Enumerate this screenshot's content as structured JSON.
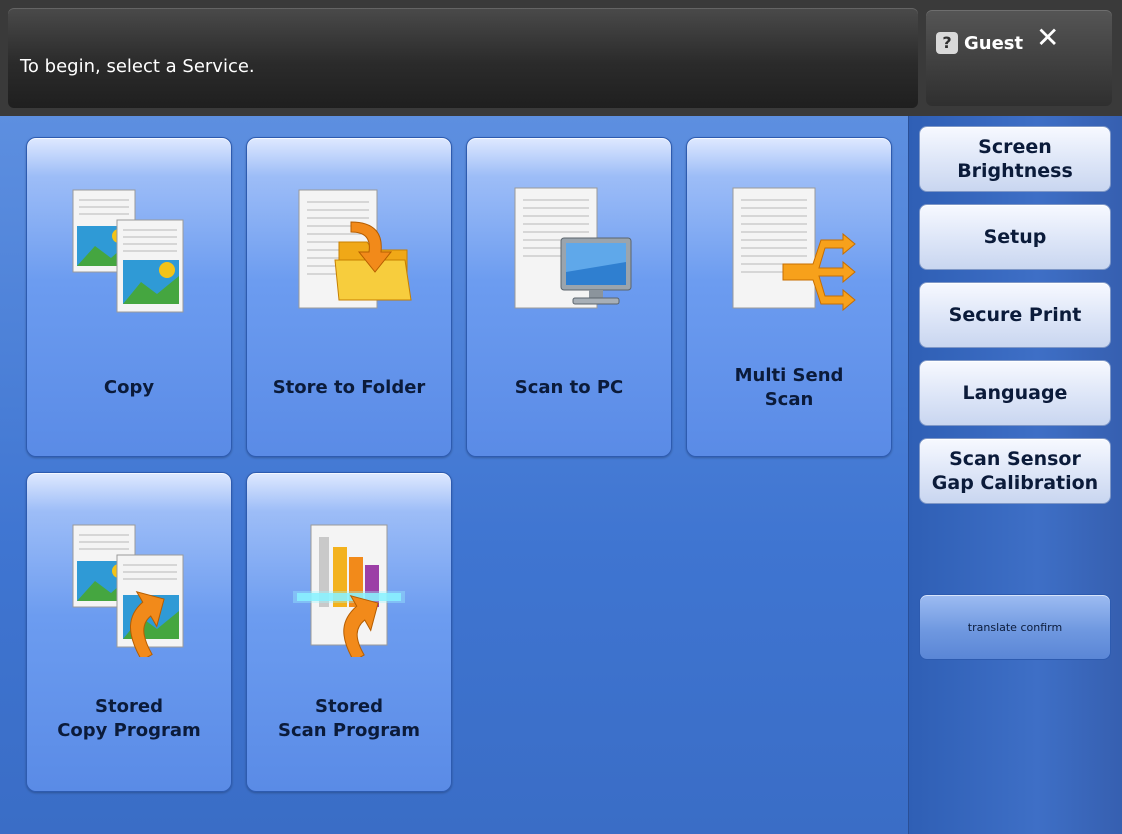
{
  "header": {
    "message": "To begin, select a Service.",
    "user_name": "Guest",
    "user_icon": "?",
    "logout_icon": "✕"
  },
  "services": [
    {
      "label_lines": [
        "Copy"
      ],
      "icon": "copy-icon"
    },
    {
      "label_lines": [
        "Store to Folder"
      ],
      "icon": "store-to-folder-icon"
    },
    {
      "label_lines": [
        "Scan to PC"
      ],
      "icon": "scan-to-pc-icon"
    },
    {
      "label_lines": [
        "Multi Send",
        "Scan"
      ],
      "icon": "multi-send-scan-icon"
    },
    {
      "label_lines": [
        "Stored",
        "Copy Program"
      ],
      "icon": "stored-copy-program-icon"
    },
    {
      "label_lines": [
        "Stored",
        "Scan Program"
      ],
      "icon": "stored-scan-program-icon"
    }
  ],
  "side_buttons": [
    {
      "lines": [
        "Screen",
        "Brightness"
      ]
    },
    {
      "lines": [
        "Setup"
      ]
    },
    {
      "lines": [
        "Secure Print"
      ]
    },
    {
      "lines": [
        "Language"
      ]
    },
    {
      "lines": [
        "Scan Sensor",
        "Gap Calibration"
      ]
    }
  ],
  "translate_confirm": "translate confirm",
  "colors": {
    "tile_blue": "#5a8be6",
    "background_blue": "#3f75d1",
    "header_dark": "#2b2b2b"
  }
}
